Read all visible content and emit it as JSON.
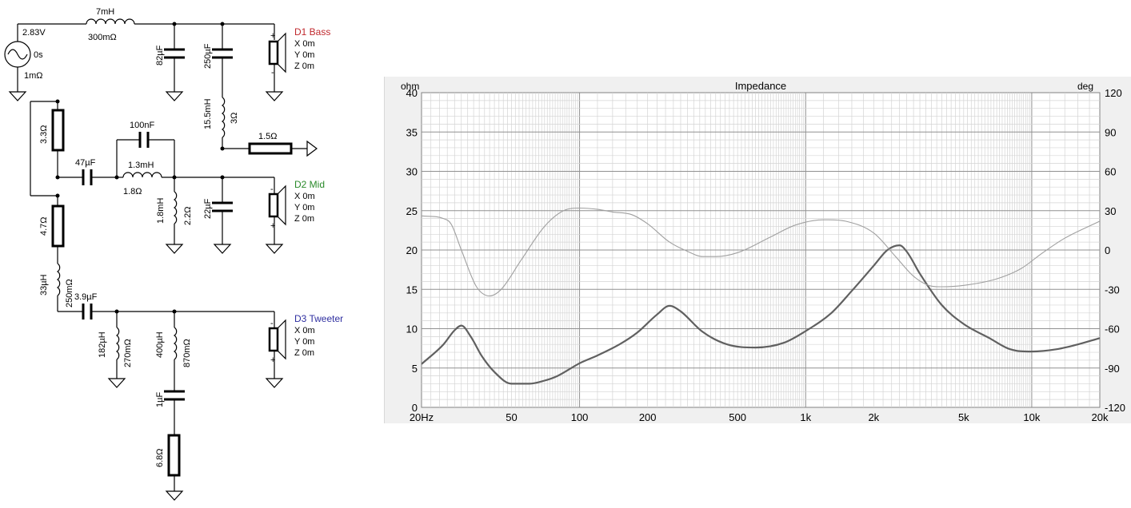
{
  "colors": {
    "wire": "#000000",
    "bass_label": "#c0282d",
    "mid_label": "#2a8a2a",
    "tweeter_label": "#2f2fa0",
    "impedance_curve": "#606060",
    "phase_curve": "#a0a0a0",
    "grid_major": "#909090",
    "grid_minor": "#d4d4d4"
  },
  "schematic": {
    "source": {
      "voltage": "2.83V",
      "delay": "0s",
      "resistance": "1mΩ"
    },
    "bass": {
      "series_inductor": {
        "value": "7mH",
        "resistance": "300mΩ"
      },
      "shunt_cap_1": "82µF",
      "shunt_cap_2": "250µF",
      "notch_inductor": {
        "value": "15.5mH",
        "resistance": "3Ω"
      },
      "notch_resistor": "1.5Ω",
      "driver": {
        "name": "D1 Bass",
        "x": "X 0m",
        "y": "Y 0m",
        "z": "Z 0m",
        "plus": "+",
        "minus": "-"
      }
    },
    "mid": {
      "attenuator_resistor": "3.3Ω",
      "series_cap": "47µF",
      "bypass_cap": "100nF",
      "series_inductor": {
        "value": "1.3mH",
        "resistance": "1.8Ω"
      },
      "shunt_inductor": {
        "value": "1.8mH",
        "resistance": "2.2Ω"
      },
      "shunt_cap": "22µF",
      "driver": {
        "name": "D2 Mid",
        "x": "X 0m",
        "y": "Y 0m",
        "z": "Z 0m",
        "plus": "+",
        "minus": "-"
      }
    },
    "tweeter": {
      "attenuator_resistor": "4.7Ω",
      "series_inductor": {
        "value": "33µH",
        "resistance": "250mΩ"
      },
      "series_cap": "3.9µF",
      "shunt_inductor_1": {
        "value": "182µH",
        "resistance": "270mΩ"
      },
      "shunt_inductor_2": {
        "value": "400µH",
        "resistance": "870mΩ"
      },
      "zobel_cap": "1µF",
      "zobel_resistor": "6.8Ω",
      "driver": {
        "name": "D3 Tweeter",
        "x": "X 0m",
        "y": "Y 0m",
        "z": "Z 0m",
        "plus": "+",
        "minus": "-"
      }
    }
  },
  "chart_data": {
    "type": "line",
    "title": "Impedance",
    "ylabel_left": "ohm",
    "ylabel_right": "deg",
    "x_scale": "log",
    "xlim": [
      20,
      20000
    ],
    "ylim_left": [
      0,
      40
    ],
    "ylim_right": [
      -120,
      120
    ],
    "x_ticks": [
      {
        "v": 20,
        "label": "20Hz"
      },
      {
        "v": 50,
        "label": "50"
      },
      {
        "v": 100,
        "label": "100"
      },
      {
        "v": 200,
        "label": "200"
      },
      {
        "v": 500,
        "label": "500"
      },
      {
        "v": 1000,
        "label": "1k"
      },
      {
        "v": 2000,
        "label": "2k"
      },
      {
        "v": 5000,
        "label": "5k"
      },
      {
        "v": 10000,
        "label": "10k"
      },
      {
        "v": 20000,
        "label": "20k"
      }
    ],
    "y_ticks_left": [
      "0",
      "5",
      "10",
      "15",
      "20",
      "25",
      "30",
      "35",
      "40"
    ],
    "y_ticks_right": [
      "-120",
      "-90",
      "-60",
      "-30",
      "0",
      "30",
      "60",
      "90",
      "120"
    ],
    "grid": true,
    "series": [
      {
        "axis": "left",
        "x": [
          20,
          25,
          28,
          30,
          33,
          37,
          42,
          50,
          60,
          70,
          80,
          100,
          120,
          150,
          180,
          220,
          250,
          280,
          350,
          450,
          600,
          800,
          1000,
          1300,
          1600,
          2000,
          2300,
          2600,
          2800,
          3200,
          4000,
          5000,
          6500,
          8000,
          10000,
          13000,
          16000,
          20000
        ],
        "y": [
          5.5,
          8.0,
          9.8,
          10.4,
          9.0,
          6.5,
          4.5,
          3.0,
          3.0,
          3.4,
          4.0,
          5.6,
          6.6,
          8.0,
          9.5,
          11.8,
          12.9,
          12.2,
          9.6,
          8.0,
          7.6,
          8.2,
          9.7,
          12.0,
          14.8,
          18.0,
          20.0,
          20.6,
          19.8,
          17.0,
          13.0,
          10.6,
          8.8,
          7.4,
          7.1,
          7.4,
          8.0,
          8.8
        ]
      },
      {
        "axis": "right",
        "x": [
          20,
          25,
          27,
          30,
          35,
          40,
          45,
          55,
          70,
          85,
          100,
          120,
          140,
          170,
          200,
          250,
          300,
          350,
          400,
          500,
          700,
          900,
          1200,
          1500,
          2000,
          2500,
          3000,
          3500,
          4000,
          5000,
          7000,
          9000,
          11000,
          14000,
          20000
        ],
        "y": [
          26,
          24,
          20,
          0,
          -28,
          -35,
          -30,
          -8,
          18,
          30,
          32,
          31,
          29,
          27,
          20,
          6,
          -1,
          -5,
          -5,
          -2,
          10,
          19,
          23,
          22,
          13,
          -5,
          -20,
          -27,
          -28,
          -27,
          -22,
          -14,
          -3,
          9,
          22
        ]
      }
    ]
  }
}
